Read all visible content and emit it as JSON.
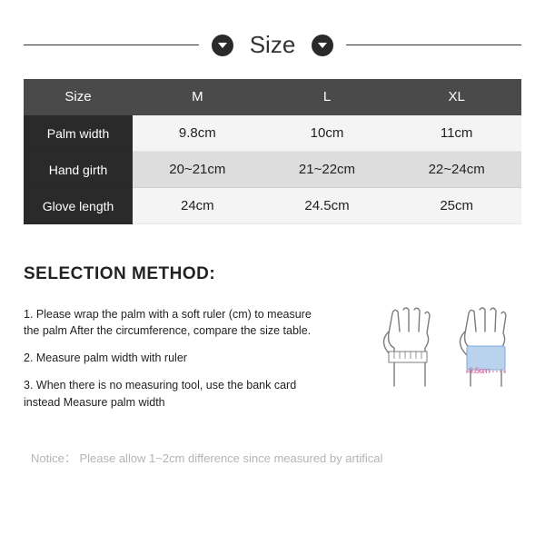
{
  "header": {
    "title": "Size",
    "left_icon": "chevron-down-icon",
    "right_icon": "chevron-down-icon"
  },
  "table": {
    "head": [
      "Size",
      "M",
      "L",
      "XL"
    ],
    "rows": [
      {
        "label": "Palm width",
        "values": [
          "9.8cm",
          "10cm",
          "11cm"
        ]
      },
      {
        "label": "Hand girth",
        "values": [
          "20~21cm",
          "21~22cm",
          "22~24cm"
        ]
      },
      {
        "label": "Glove length",
        "values": [
          "24cm",
          "24.5cm",
          "25cm"
        ]
      }
    ]
  },
  "selection": {
    "heading": "SELECTION METHOD:",
    "steps": [
      "1. Please wrap the palm with a soft ruler (cm) to measure the palm After the circumference, compare the size table.",
      "2. Measure palm width with ruler",
      "3. When there is no measuring tool, use the bank card instead Measure palm width"
    ],
    "illus_label": "8.5cm"
  },
  "notice": "Notice： Please allow 1~2cm difference since measured by artifical"
}
